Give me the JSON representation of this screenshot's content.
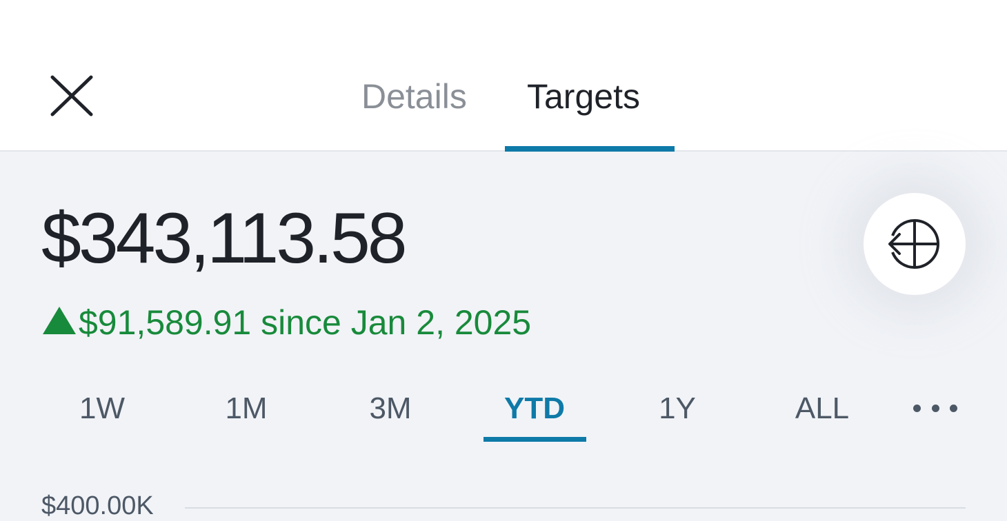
{
  "header": {
    "tabs": [
      {
        "label": "Details",
        "active": false
      },
      {
        "label": "Targets",
        "active": true
      }
    ]
  },
  "summary": {
    "balance": "$343,113.58",
    "change_text": "$91,589.91 since Jan 2, 2025",
    "change_color": "#188a3b"
  },
  "ranges": [
    {
      "label": "1W",
      "active": false
    },
    {
      "label": "1M",
      "active": false
    },
    {
      "label": "3M",
      "active": false
    },
    {
      "label": "YTD",
      "active": true
    },
    {
      "label": "1Y",
      "active": false
    },
    {
      "label": "ALL",
      "active": false
    }
  ],
  "chart": {
    "y_top_label": "$400.00K"
  },
  "colors": {
    "accent": "#0e7aa8",
    "text_primary": "#1f2228",
    "text_muted": "#8a8f97"
  },
  "icons": {
    "close": "close-icon",
    "fab": "target-arrow-icon",
    "more": "more-horizontal-icon"
  }
}
